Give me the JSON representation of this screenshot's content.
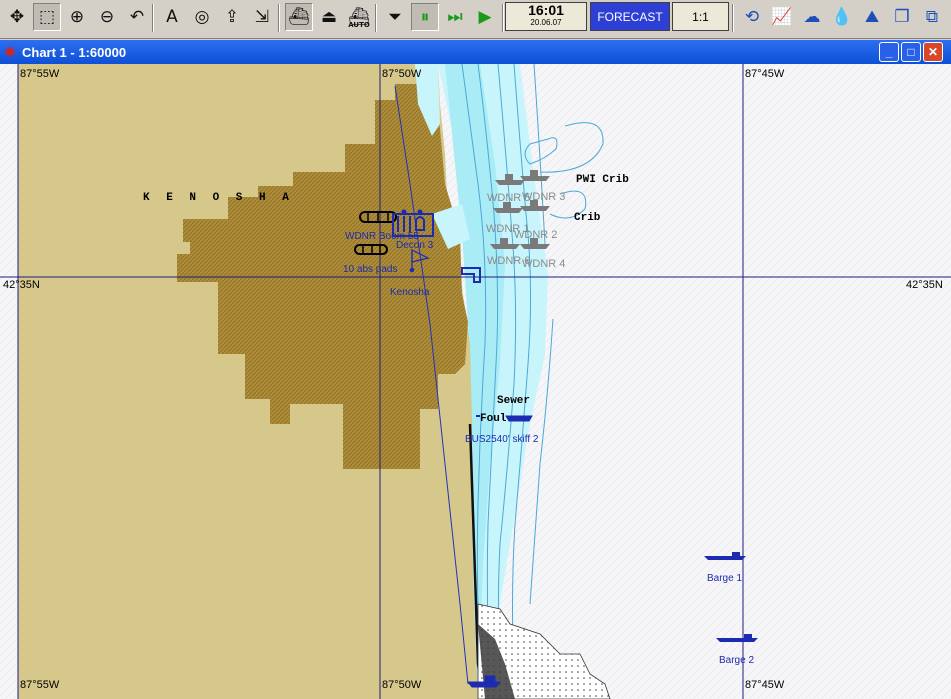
{
  "toolbar": {
    "buttons": [
      {
        "name": "pan-icon",
        "glyph": "✥"
      },
      {
        "name": "select-zoom-icon",
        "glyph": "⬚"
      },
      {
        "name": "zoom-in-icon",
        "glyph": "⊕"
      },
      {
        "name": "zoom-out-icon",
        "glyph": "⊖"
      },
      {
        "name": "undo-icon",
        "glyph": "↶"
      },
      {
        "name": "north-arrow-icon",
        "glyph": "A"
      },
      {
        "name": "target-icon",
        "glyph": "◎"
      },
      {
        "name": "export-icon",
        "glyph": "⇪"
      },
      {
        "name": "import-icon",
        "glyph": "⇲"
      },
      {
        "name": "ship-view-icon",
        "glyph": "⛴"
      },
      {
        "name": "vessel-icon",
        "glyph": "⏏"
      },
      {
        "name": "auto-mode-icon",
        "glyph": "⛴",
        "sub": "AUTO"
      },
      {
        "name": "stop-icon",
        "glyph": "⏷"
      },
      {
        "name": "pause-icon",
        "glyph": "⏸"
      },
      {
        "name": "fast-forward-icon",
        "glyph": "⏭"
      },
      {
        "name": "play-icon",
        "glyph": "▶"
      },
      {
        "name": "weather-icon",
        "glyph": "⟲"
      },
      {
        "name": "graph-icon",
        "glyph": "📈"
      },
      {
        "name": "wind-icon",
        "glyph": "☁"
      },
      {
        "name": "oil-drop-icon",
        "glyph": "💧"
      },
      {
        "name": "shore-icon",
        "glyph": "⛰"
      },
      {
        "name": "layers-icon",
        "glyph": "❐"
      },
      {
        "name": "windows-icon",
        "glyph": "⧉"
      }
    ],
    "time": "16:01",
    "date": "20.06.07",
    "forecast_label": "FORECAST",
    "scale_label": "1:1"
  },
  "window": {
    "title": "Chart 1 - 1:60000",
    "minimize": "_",
    "maximize": "□",
    "close": "✕"
  },
  "chart": {
    "grid_labels": {
      "lon_left_top": "87°55W",
      "lon_mid_top": "87°50W",
      "lon_right_top": "87°45W",
      "lon_left_bottom": "87°55W",
      "lon_mid_bottom": "87°50W",
      "lon_right_bottom": "87°45W",
      "lat_left": "42°35N",
      "lat_right": "42°35N"
    },
    "place_labels": {
      "town": "K E N O S H A",
      "port": "Kenosha",
      "pwi_crib": "PWI Crib",
      "crib": "Crib",
      "sewer": "Sewer",
      "foul": "Foul"
    },
    "gray_labels": {
      "wdnr3": "WDNR 3",
      "wdnr5": "WDNR 5",
      "wdnr1": "WDNR 1",
      "wdnr2": "WDNR 2",
      "wdnr6": "WDNR 6",
      "wdnr4": "WDNR 4"
    },
    "vessel_labels": {
      "wdnr_boom": "WDNR Boom 55",
      "decon": "Decon 3",
      "pads": "10 abs pads",
      "skiff": "BUS2540' skiff 2",
      "barge1": "Barge 1",
      "barge2": "Barge 2"
    },
    "colors": {
      "land": "#d6c78a",
      "urban": "#ad8c3a",
      "water_shallow": "#c8f5fb",
      "water_deep": "#f4f3f6",
      "vessel": "#1c2bb0"
    }
  }
}
